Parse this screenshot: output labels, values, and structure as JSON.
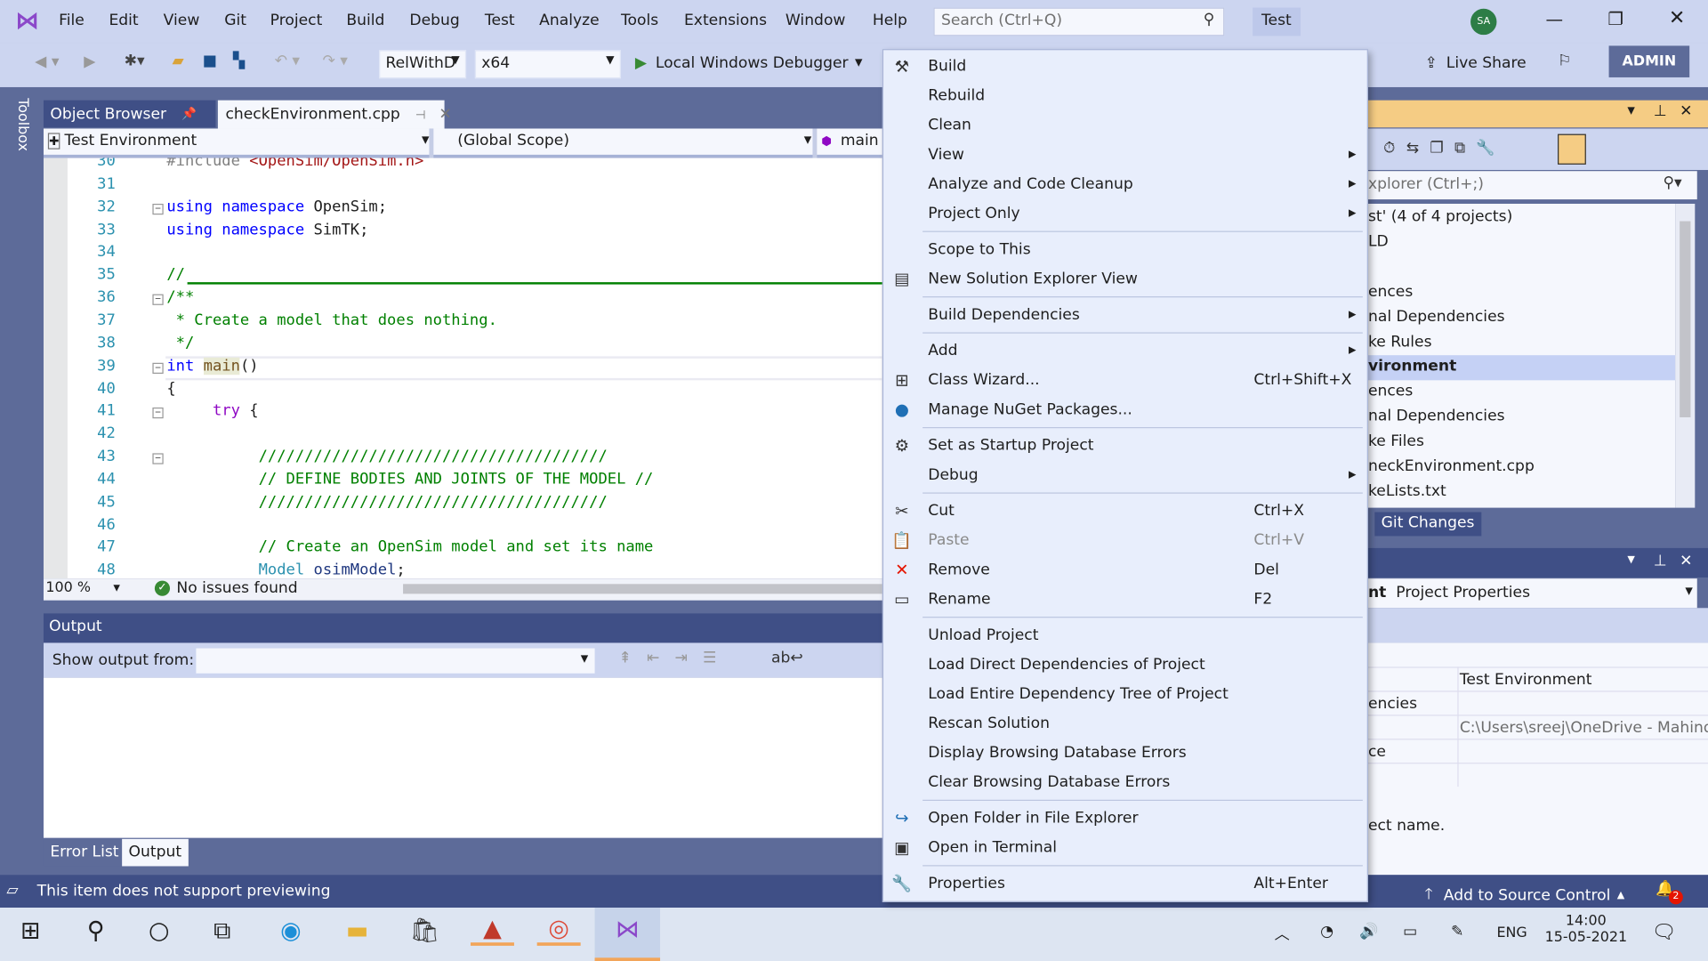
{
  "menubar": {
    "items": [
      "File",
      "Edit",
      "View",
      "Git",
      "Project",
      "Build",
      "Debug",
      "Test",
      "Analyze",
      "Tools",
      "Extensions",
      "Window",
      "Help"
    ],
    "search_placeholder": "Search (Ctrl+Q)",
    "solution_name": "Test",
    "avatar": "SA"
  },
  "toolbar": {
    "config": "RelWithD",
    "platform": "x64",
    "debugger": "Local Windows Debugger",
    "live_share": "Live Share",
    "admin": "ADMIN"
  },
  "toolbox": {
    "label": "Toolbox"
  },
  "tabs": [
    {
      "label": "Object Browser"
    },
    {
      "label": "checkEnvironment.cpp"
    }
  ],
  "navbar": {
    "project": "Test Environment",
    "scope": "(Global Scope)",
    "member": "main"
  },
  "code": {
    "lines": [
      {
        "n": "30",
        "html": "<span style='color:#808080'>#include</span> <span class='st'>&lt;OpenSim/OpenSim.h&gt;</span>"
      },
      {
        "n": "31",
        "html": ""
      },
      {
        "n": "32",
        "html": "<span class='kw'>using namespace</span> OpenSim;"
      },
      {
        "n": "33",
        "html": "<span class='kw'>using namespace</span> SimTK;"
      },
      {
        "n": "34",
        "html": ""
      },
      {
        "n": "35",
        "html": "<span class='cm'>//</span>"
      },
      {
        "n": "36",
        "html": "<span class='cm'>/**</span>"
      },
      {
        "n": "37",
        "html": "<span class='cm'> * Create a model that does nothing.</span>"
      },
      {
        "n": "38",
        "html": "<span class='cm'> */</span>"
      },
      {
        "n": "39",
        "html": "<span class='kw'>int</span> <span class='fn'>main</span>()"
      },
      {
        "n": "40",
        "html": "{"
      },
      {
        "n": "41",
        "html": "     <span class='ctl'>try</span> {"
      },
      {
        "n": "42",
        "html": ""
      },
      {
        "n": "43",
        "html": "          <span class='cm'>//////////////////////////////////////</span>"
      },
      {
        "n": "44",
        "html": "          <span class='cm'>// DEFINE BODIES AND JOINTS OF THE MODEL //</span>"
      },
      {
        "n": "45",
        "html": "          <span class='cm'>//////////////////////////////////////</span>"
      },
      {
        "n": "46",
        "html": ""
      },
      {
        "n": "47",
        "html": "          <span class='cm'>// Create an OpenSim model and set its name</span>"
      },
      {
        "n": "48",
        "html": "          <span style='color:#2b91af'>Model</span> <span style='color:#1f377f'>osimModel</span>;"
      }
    ]
  },
  "editor_status": {
    "zoom": "100 %",
    "issues": "No issues found"
  },
  "output": {
    "title": "Output",
    "show_from": "Show output from:",
    "tabs": [
      "Error List",
      "Output"
    ]
  },
  "context_menu": [
    {
      "label": "Build",
      "icon": "build-icon"
    },
    {
      "label": "Rebuild"
    },
    {
      "label": "Clean"
    },
    {
      "label": "View",
      "sub": true
    },
    {
      "label": "Analyze and Code Cleanup",
      "sub": true
    },
    {
      "label": "Project Only",
      "sub": true
    },
    {
      "sep": true
    },
    {
      "label": "Scope to This"
    },
    {
      "label": "New Solution Explorer View",
      "icon": "new-view-icon"
    },
    {
      "sep": true
    },
    {
      "label": "Build Dependencies",
      "sub": true
    },
    {
      "sep": true
    },
    {
      "label": "Add",
      "sub": true
    },
    {
      "label": "Class Wizard...",
      "shortcut": "Ctrl+Shift+X",
      "icon": "class-wizard-icon"
    },
    {
      "label": "Manage NuGet Packages...",
      "icon": "nuget-icon"
    },
    {
      "sep": true
    },
    {
      "label": "Set as Startup Project",
      "icon": "gear-icon"
    },
    {
      "label": "Debug",
      "sub": true
    },
    {
      "sep": true
    },
    {
      "label": "Cut",
      "shortcut": "Ctrl+X",
      "icon": "scissors-icon"
    },
    {
      "label": "Paste",
      "shortcut": "Ctrl+V",
      "icon": "paste-icon",
      "disabled": true
    },
    {
      "label": "Remove",
      "shortcut": "Del",
      "icon": "remove-icon"
    },
    {
      "label": "Rename",
      "shortcut": "F2",
      "icon": "rename-icon"
    },
    {
      "sep": true
    },
    {
      "label": "Unload Project"
    },
    {
      "label": "Load Direct Dependencies of Project"
    },
    {
      "label": "Load Entire Dependency Tree of Project"
    },
    {
      "label": "Rescan Solution"
    },
    {
      "label": "Display Browsing Database Errors"
    },
    {
      "label": "Clear Browsing Database Errors"
    },
    {
      "sep": true
    },
    {
      "label": "Open Folder in File Explorer",
      "icon": "open-folder-icon"
    },
    {
      "label": "Open in Terminal",
      "icon": "terminal-icon"
    },
    {
      "sep": true
    },
    {
      "label": "Properties",
      "shortcut": "Alt+Enter",
      "icon": "wrench-icon"
    }
  ],
  "solution_explorer": {
    "search_placeholder": "xplorer (Ctrl+;)",
    "items": [
      "st' (4 of 4 projects)",
      "LD",
      "",
      "ences",
      "nal Dependencies",
      "ke Rules",
      "vironment",
      "ences",
      "nal Dependencies",
      "ke Files",
      "neckEnvironment.cpp",
      "keLists.txt"
    ],
    "git_tab": "Git Changes"
  },
  "properties": {
    "header_bold": "nt",
    "header": "Project Properties",
    "value_name": "Test Environment",
    "label1": "encies",
    "value_path": "C:\\Users\\sreej\\OneDrive - Mahind",
    "label2": "ce",
    "desc": "ect name."
  },
  "statusbar": {
    "message": "This item does not support previewing",
    "source_control": "Add to Source Control",
    "notifications": "2"
  },
  "taskbar": {
    "language": "ENG",
    "time": "14:00",
    "date": "15-05-2021"
  },
  "colors": {
    "accent": "#5d6b99",
    "menu_bg": "#e8eefc",
    "active_header": "#f5cc84"
  }
}
